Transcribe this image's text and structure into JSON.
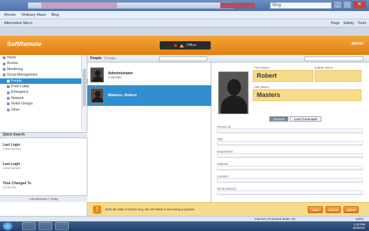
{
  "browser": {
    "search_placeholder": "Bing",
    "menu": [
      "Mondo",
      "Ordinary Mass",
      "Bing"
    ],
    "favorites_bar": "Alternative Meco",
    "toolbar_right": [
      "Page",
      "Safety",
      "Tools"
    ],
    "status_zone": "Internet | Protected Mode: On",
    "zoom": "100%"
  },
  "app": {
    "logo": "SoftRemote",
    "nav_label": "Office",
    "user": "admin"
  },
  "sidebar": {
    "tree": [
      {
        "label": "Home",
        "selected": false
      },
      {
        "label": "Access",
        "selected": false
      },
      {
        "label": "Monitoring",
        "selected": false
      },
      {
        "label": "Group Management",
        "selected": false
      },
      {
        "label": "People",
        "selected": true
      },
      {
        "label": "Front Lobby",
        "selected": false
      },
      {
        "label": "Emergency",
        "selected": false
      },
      {
        "label": "Network",
        "selected": false
      },
      {
        "label": "Visitor Groups",
        "selected": false
      },
      {
        "label": "Other",
        "selected": false
      }
    ],
    "section_title": "Quick Search",
    "quick_links": [
      {
        "title": "Last Login",
        "sub": "Administrator"
      },
      {
        "title": "Last Login",
        "sub": "Administrator"
      },
      {
        "title": "Time Changed To",
        "sub": "12:00 AM"
      }
    ],
    "footer": "Administrator  |  Today"
  },
  "list": {
    "tab_active": "People",
    "tab_inactive": "Groups",
    "people": [
      {
        "name": "Administrator",
        "sub": "Controller",
        "selected": false
      },
      {
        "name": "Masters, Robert",
        "sub": "",
        "selected": true
      }
    ]
  },
  "detail": {
    "first_name_label": "First Name",
    "first_name": "Robert",
    "middle_label": "Middle Name",
    "last_name_label": "Last Name",
    "last_name": "Masters",
    "tabs": [
      "General",
      "Card Credentials"
    ],
    "fields": [
      "Person ID",
      "Title",
      "Department",
      "Address",
      "Location",
      "Tel Number(s)"
    ]
  },
  "infobar": {
    "message": "Both the date of Grand Jury, the 4th Week is becoming a popular.",
    "buttons": [
      "Save",
      "Cancel",
      "Delete"
    ]
  },
  "taskbar": {
    "time": "1:42 PM",
    "date": "6/4/2010"
  }
}
